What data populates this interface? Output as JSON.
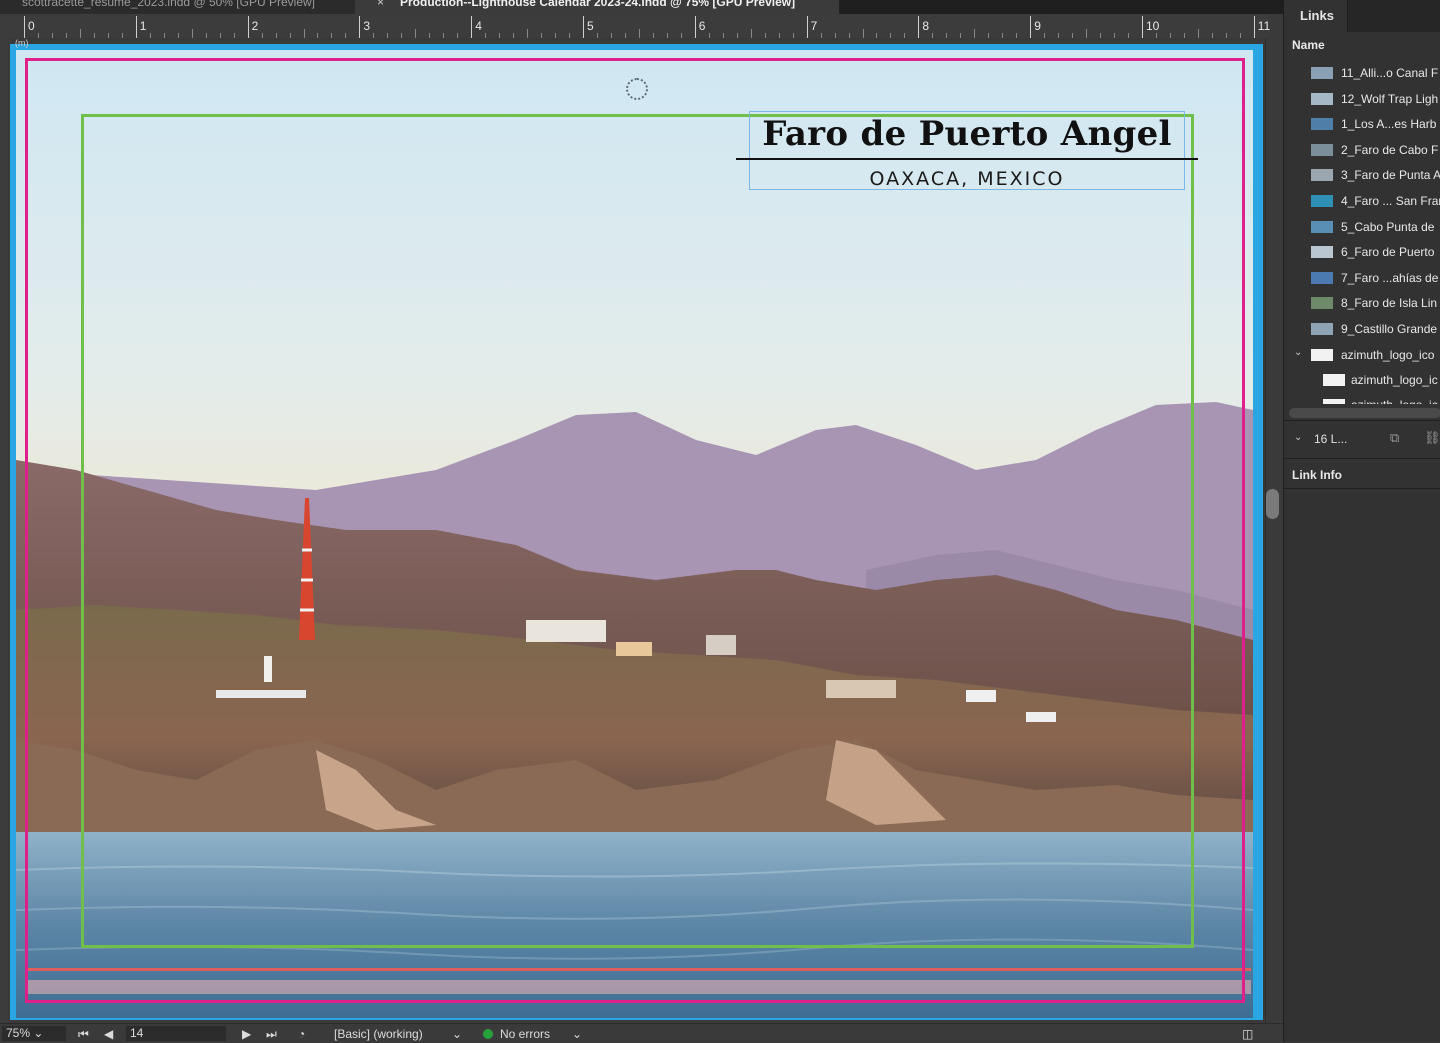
{
  "tabs": [
    {
      "label": "scottracette_resume_2023.indd @ 50% [GPU Preview]"
    },
    {
      "label": "Production--Lighthouse Calendar 2023-24.indd @ 75% [GPU Preview]",
      "close": "×"
    }
  ],
  "ruler": {
    "marks": [
      "0",
      "1",
      "2",
      "3",
      "4",
      "5",
      "6",
      "7",
      "8",
      "9",
      "10",
      "11"
    ]
  },
  "page": {
    "title": "Faro de Puerto Angel",
    "subtitle": "OAXACA, MEXICO",
    "page_icon": "(m)"
  },
  "statusbar": {
    "zoom": "75%",
    "page_number": "14",
    "preflight_profile": "[Basic] (working)",
    "errors": "No errors"
  },
  "links_panel": {
    "tab_label": "Links",
    "column_header": "Name",
    "items": [
      {
        "label": "11_Alli...o Canal F"
      },
      {
        "label": "12_Wolf Trap Ligh"
      },
      {
        "label": "1_Los A...es Harb"
      },
      {
        "label": "2_Faro de Cabo F"
      },
      {
        "label": "3_Faro de Punta A"
      },
      {
        "label": "4_Faro ... San Fran"
      },
      {
        "label": "5_Cabo Punta de"
      },
      {
        "label": "6_Faro de Puerto"
      },
      {
        "label": "7_Faro ...ahías de"
      },
      {
        "label": "8_Faro de Isla Lin"
      },
      {
        "label": "9_Castillo Grande"
      },
      {
        "label": "azimuth_logo_ico"
      },
      {
        "label": "azimuth_logo_ic"
      },
      {
        "label": "azimuth_logo_ic"
      }
    ],
    "pages_summary": "16 L...",
    "link_info_label": "Link Info"
  },
  "colors": {
    "bleed": "#2aa7e2",
    "margin": "#e0208a",
    "column_guide": "#6fbf4a",
    "frame": "#79b8e8"
  }
}
